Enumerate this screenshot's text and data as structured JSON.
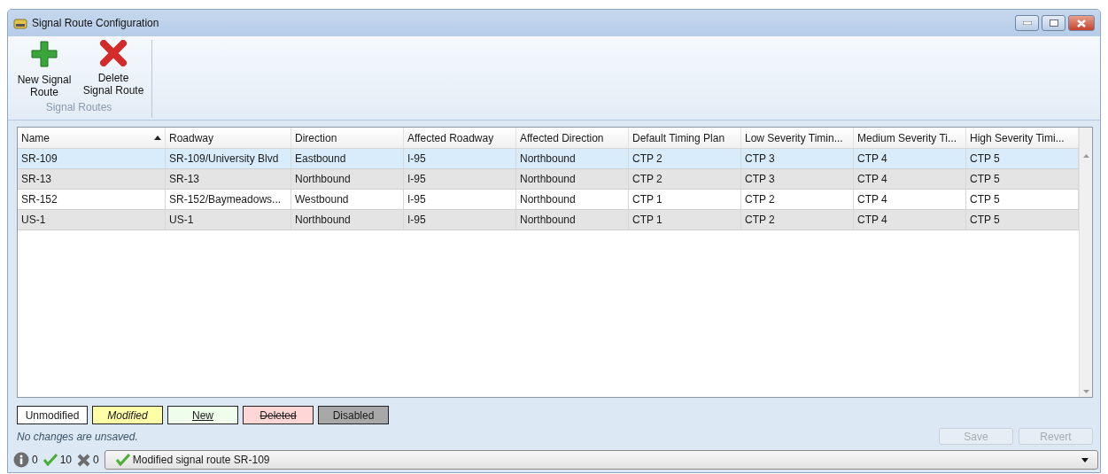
{
  "window": {
    "title": "Signal Route Configuration"
  },
  "ribbon": {
    "buttons": [
      {
        "kind": "add",
        "label": "New Signal Route"
      },
      {
        "kind": "delete",
        "label": "Delete Signal Route"
      }
    ],
    "group_label": "Signal Routes"
  },
  "table": {
    "columns": [
      {
        "label": "Name",
        "sorted": true
      },
      {
        "label": "Roadway",
        "sorted": false
      },
      {
        "label": "Direction",
        "sorted": false
      },
      {
        "label": "Affected Roadway",
        "sorted": false
      },
      {
        "label": "Affected Direction",
        "sorted": false
      },
      {
        "label": "Default Timing Plan",
        "sorted": false
      },
      {
        "label": "Low Severity Timin...",
        "sorted": false
      },
      {
        "label": "Medium Severity Ti...",
        "sorted": false
      },
      {
        "label": "High Severity Timi...",
        "sorted": false
      }
    ],
    "rows": [
      {
        "selected": true,
        "cells": [
          "SR-109",
          "SR-109/University Blvd",
          "Eastbound",
          "I-95",
          "Northbound",
          "CTP 2",
          "CTP 3",
          "CTP 4",
          "CTP 5"
        ]
      },
      {
        "selected": false,
        "cells": [
          "SR-13",
          "SR-13",
          "Northbound",
          "I-95",
          "Northbound",
          "CTP 2",
          "CTP 3",
          "CTP 4",
          "CTP 5"
        ]
      },
      {
        "selected": false,
        "cells": [
          "SR-152",
          "SR-152/Baymeadows...",
          "Westbound",
          "I-95",
          "Northbound",
          "CTP 1",
          "CTP 2",
          "CTP 4",
          "CTP 5"
        ]
      },
      {
        "selected": false,
        "cells": [
          "US-1",
          "US-1",
          "Northbound",
          "I-95",
          "Northbound",
          "CTP 1",
          "CTP 2",
          "CTP 4",
          "CTP 5"
        ]
      }
    ]
  },
  "legend": [
    {
      "kind": "unmodified",
      "label": "Unmodified"
    },
    {
      "kind": "modified",
      "label": "Modified"
    },
    {
      "kind": "new",
      "label": "New"
    },
    {
      "kind": "deleted",
      "label": "Deleted"
    },
    {
      "kind": "disabled",
      "label": "Disabled"
    }
  ],
  "changes_note": "No changes are unsaved.",
  "actions": [
    {
      "label": "Save",
      "disabled": true
    },
    {
      "label": "Revert",
      "disabled": true
    }
  ],
  "status_bar": {
    "counts": [
      {
        "kind": "info",
        "value": "0"
      },
      {
        "kind": "success",
        "value": "10"
      },
      {
        "kind": "error",
        "value": "0"
      }
    ],
    "message": "Modified signal route SR-109"
  }
}
